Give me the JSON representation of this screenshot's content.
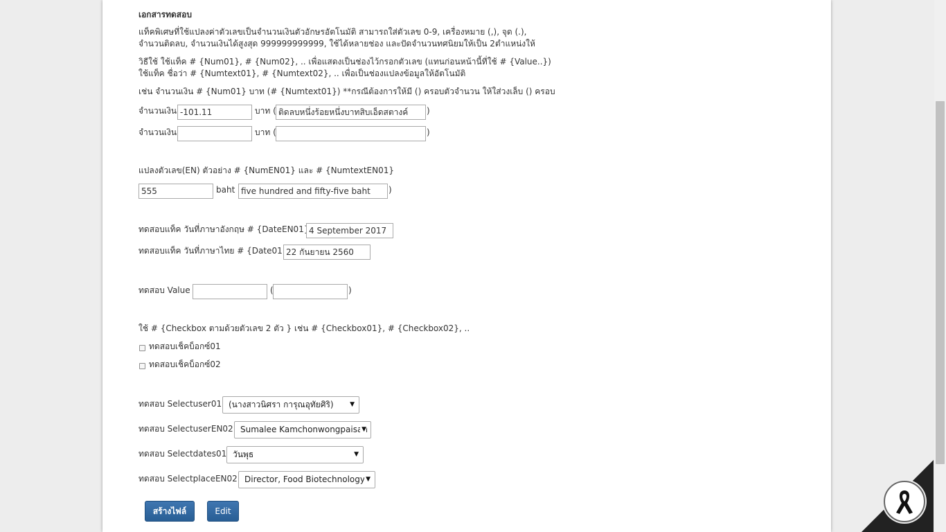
{
  "doc": {
    "title": "เอกสารทดสอบ",
    "intro_line1": "แท็คพิเศษที่ใช้แปลงค่าตัวเลขเป็นจำนวนเงินตัวอักษรอัตโนมัติ สามารถใส่ตัวเลข 0-9, เครื่องหมาย (,), จุด (.),",
    "intro_line2": "จำนวนติดลบ, จำนวนเงินได้สูงสุด 999999999999, ใช้ได้หลายช่อง และปัดจำนวนทศนิยมให้เป็น 2ตำแหน่งให้",
    "usage_line1": "วิธีใช้ ใช้แท็ค # {Num01}, # {Num02}, .. เพื่อแสดงเป็นช่องไว้กรอกตัวเลข (แทนก่อนหน้านี้ที่ใช้ # {Value..})",
    "usage_line2": "ใช้แท็ค ชื่อว่า # {Numtext01}, # {Numtext02}, .. เพื่อเป็นช่องแปลงข้อมูลให้อัตโนมัติ",
    "example_line": "เช่น จำนวนเงิน # {Num01} บาท (# {Numtext01}) **กรณีต้องการให้มี () ครอบตัวจำนวน ให้ใส่วงเล็บ () ครอบ"
  },
  "amount_rows": [
    {
      "label": "จำนวนเงิน",
      "number_value": "-101.11",
      "unit": "บาท (",
      "text_value": "ติดลบหนึ่งร้อยหนึ่งบาทสิบเอ็ดสตางค์",
      "close": ")"
    },
    {
      "label": "จำนวนเงิน",
      "number_value": "",
      "unit": "บาท (",
      "text_value": "",
      "close": ")"
    }
  ],
  "en_section": {
    "heading": "แปลงตัวเลข(EN) ตัวอย่าง # {NumEN01} และ # {NumtextEN01}",
    "number_value": "555",
    "unit": "baht (",
    "text_value": "five hundred and fifty-five baht",
    "close": ")"
  },
  "date_section": {
    "en_label": "ทดสอบแท็ค วันที่ภาษาอังกฤษ # {DateEN01}",
    "en_value": "4 September 2017",
    "th_label": "ทดสอบแท็ค วันที่ภาษาไทย # {Date01}",
    "th_value": "22 กันยายน 2560"
  },
  "value_section": {
    "label": "ทดสอบ Value",
    "value1": "",
    "open": "(",
    "value2": "",
    "close": ")"
  },
  "checkbox_section": {
    "heading": "ใช้ # {Checkbox ตามด้วยตัวเลข 2 ตัว } เช่น # {Checkbox01}, # {Checkbox02}, ..",
    "items": [
      {
        "label": "ทดสอบเช็คบ็อกซ์01",
        "checked": false
      },
      {
        "label": "ทดสอบเช็คบ็อกซ์02",
        "checked": false
      }
    ]
  },
  "selects": [
    {
      "label": "ทดสอบ Selectuser01",
      "value": "(นางสาวนิศรา การุณอุทัยศิริ)"
    },
    {
      "label": "ทดสอบ SelectuserEN02",
      "value": "Sumalee Kamchonwongpaisan"
    },
    {
      "label": "ทดสอบ Selectdates01",
      "value": "วันพุธ"
    },
    {
      "label": "ทดสอบ SelectplaceEN02",
      "value": "Director, Food Biotechnology"
    }
  ],
  "buttons": {
    "create_label": "สร้างไฟล์",
    "edit_label": "Edit"
  },
  "icons": {
    "arrow": "▼"
  }
}
